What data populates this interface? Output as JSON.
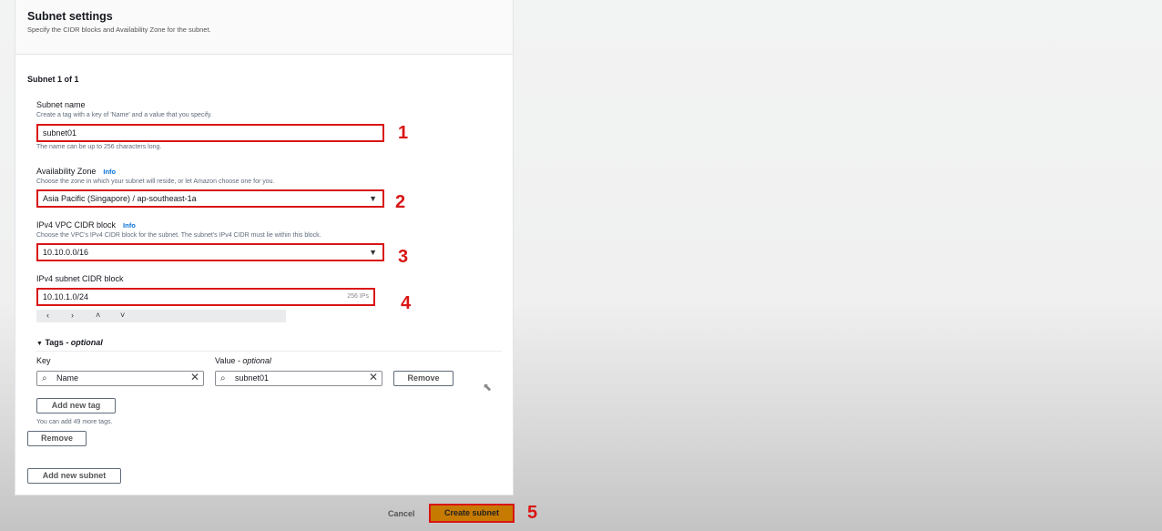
{
  "header": {
    "title": "Subnet settings",
    "description": "Specify the CIDR blocks and Availability Zone for the subnet."
  },
  "subnet_count": "Subnet 1 of 1",
  "subnet_name": {
    "label": "Subnet name",
    "hint": "Create a tag with a key of 'Name' and a value that you specify.",
    "value": "subnet01",
    "constraint": "The name can be up to 256 characters long."
  },
  "availability_zone": {
    "label": "Availability Zone",
    "info": "Info",
    "hint": "Choose the zone in which your subnet will reside, or let Amazon choose one for you.",
    "value": "Asia Pacific (Singapore) / ap-southeast-1a"
  },
  "vpc_cidr": {
    "label": "IPv4 VPC CIDR block",
    "info": "Info",
    "hint": "Choose the VPC's IPv4 CIDR block for the subnet. The subnet's IPv4 CIDR must lie within this block.",
    "value": "10.10.0.0/16"
  },
  "subnet_cidr": {
    "label": "IPv4 subnet CIDR block",
    "value": "10.10.1.0/24",
    "ip_count": "256 IPs"
  },
  "cidr_nav": {
    "prev": "‹",
    "next": "›",
    "up": "˄",
    "down": "˅"
  },
  "tags": {
    "toggle": "▼",
    "title": "Tags",
    "optional": "- optional",
    "key_label": "Key",
    "value_label": "Value",
    "value_optional": "- optional",
    "key_value": "Name",
    "value_value": "subnet01",
    "remove_label": "Remove",
    "add_label": "Add new tag",
    "limit_note": "You can add 49 more tags."
  },
  "remove_subnet_label": "Remove",
  "add_subnet_label": "Add new subnet",
  "footer": {
    "cancel_label": "Cancel",
    "create_label": "Create subnet"
  },
  "annotations": [
    "1",
    "2",
    "3",
    "4",
    "5"
  ],
  "icons": {
    "search": "⌕",
    "clear": "✕",
    "dropdown": "▼",
    "cursor": "⬉"
  },
  "colors": {
    "highlight": "#d91515",
    "primary_button": "#c77a00",
    "link": "#0972d3"
  }
}
